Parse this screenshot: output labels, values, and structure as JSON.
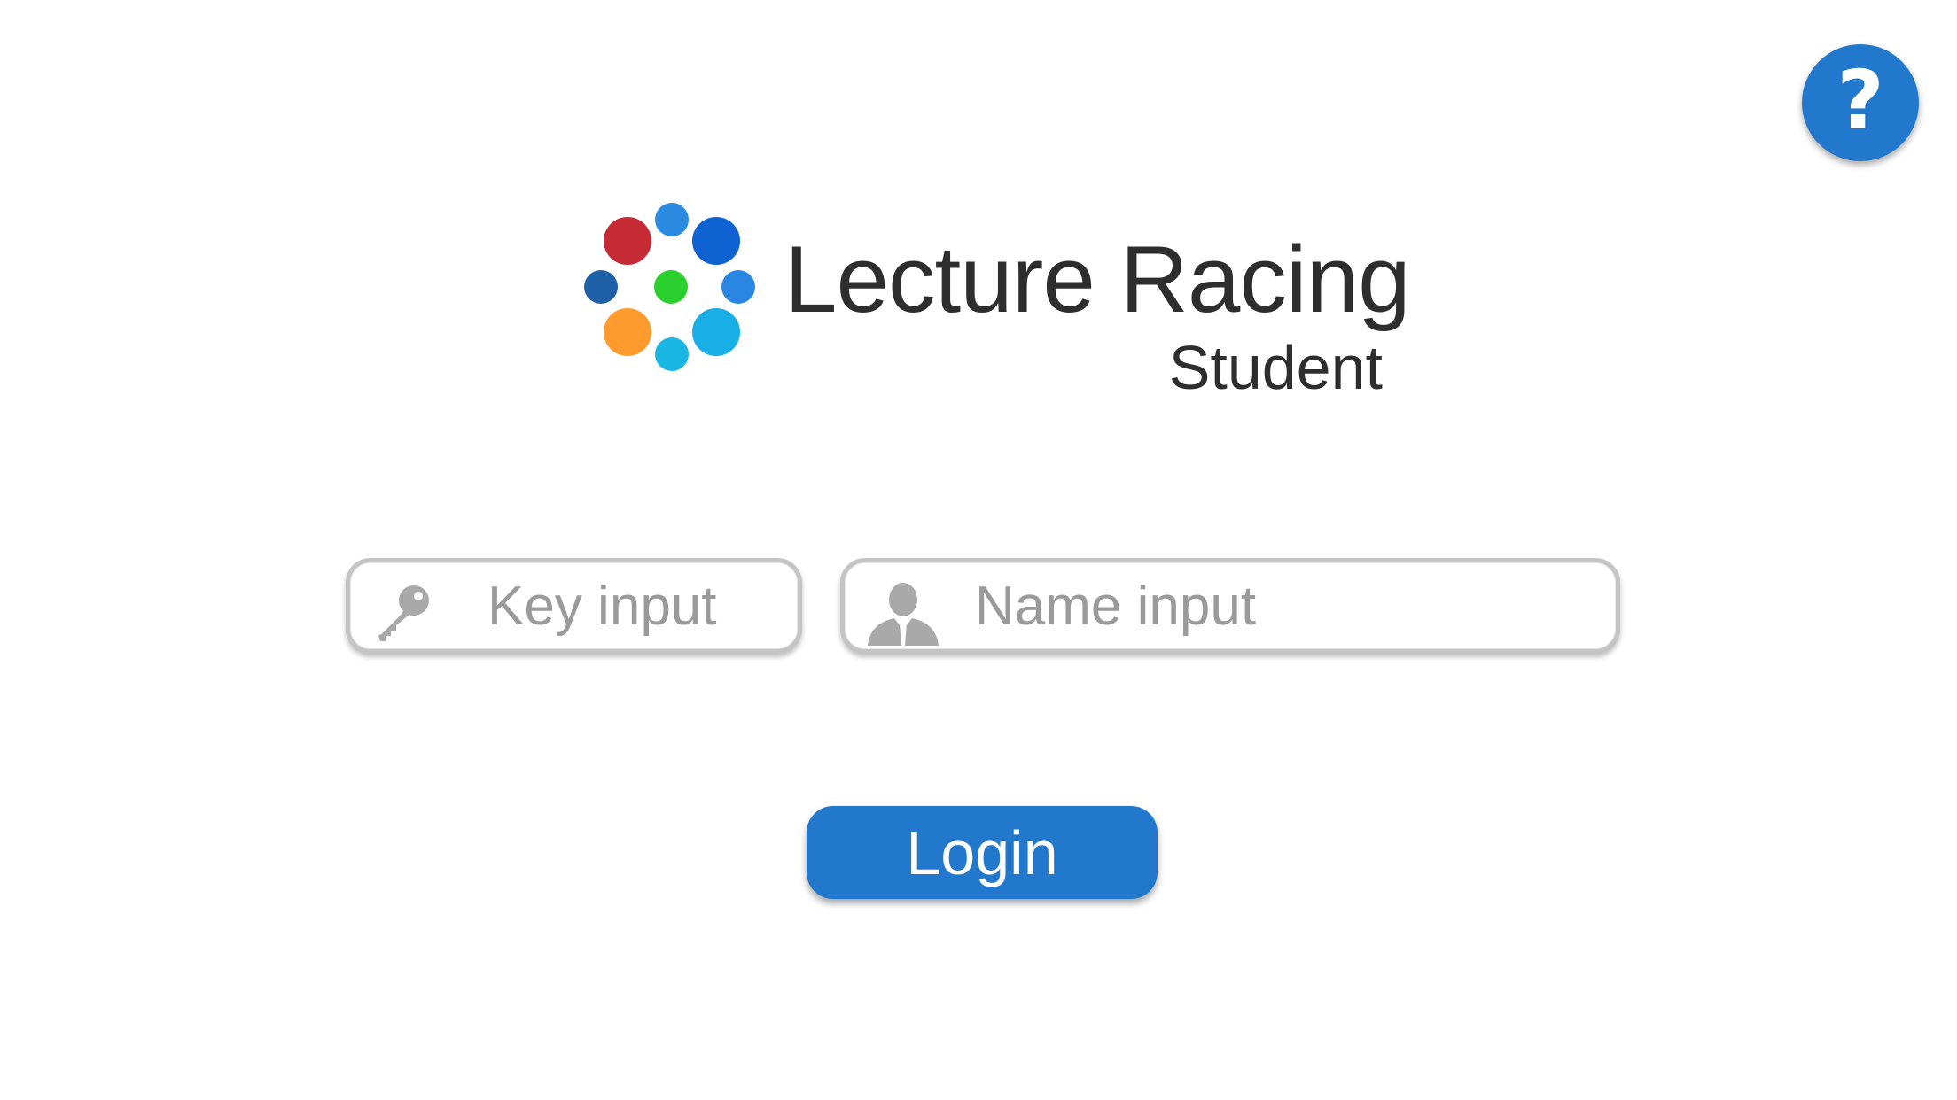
{
  "app": {
    "title": "Lecture Racing",
    "subtitle": "Student"
  },
  "help": {
    "label": "?",
    "icon": "help-icon",
    "color": "#2278cc"
  },
  "logo": {
    "icon": "logo-dots-icon",
    "dot_colors": [
      "#c62a34",
      "#2a8be0",
      "#0f62d1",
      "#2a86e3",
      "#1aaee6",
      "#1ab6e4",
      "#ff9a2e",
      "#1f61a8",
      "#2bd02e"
    ]
  },
  "form": {
    "key": {
      "placeholder": "Key input",
      "value": "",
      "icon": "key-icon"
    },
    "name": {
      "placeholder": "Name input",
      "value": "",
      "icon": "user-icon"
    }
  },
  "login": {
    "label": "Login",
    "color": "#2278cc"
  }
}
